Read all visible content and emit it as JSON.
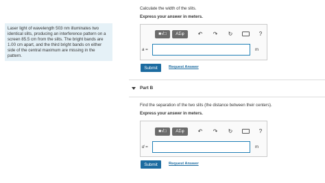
{
  "problem": {
    "text": "Laser light of wavelength 503 nm illuminates two identical slits, producing an interference pattern on a screen 85.5 cm from the slits. The bright bands are 1.00 cm apart, and the third bright bands on either side of the central maximum are missing in the pattern."
  },
  "part_a": {
    "question": "Calculate the width of the slits.",
    "instruction": "Express your answer in meters.",
    "toolbar": {
      "templates": "■√□",
      "symbols": "ΑΣφ",
      "help": "?"
    },
    "var_label": "a =",
    "unit": "m",
    "submit": "Submit",
    "request": "Request Answer"
  },
  "part_b": {
    "title": "Part B",
    "question": "Find the separation of the two slits (the distance between their centers).",
    "instruction": "Express your answer in meters.",
    "toolbar": {
      "templates": "■√□",
      "symbols": "ΑΣφ",
      "help": "?"
    },
    "var_label": "d =",
    "unit": "m",
    "submit": "Submit",
    "request": "Request Answer"
  }
}
